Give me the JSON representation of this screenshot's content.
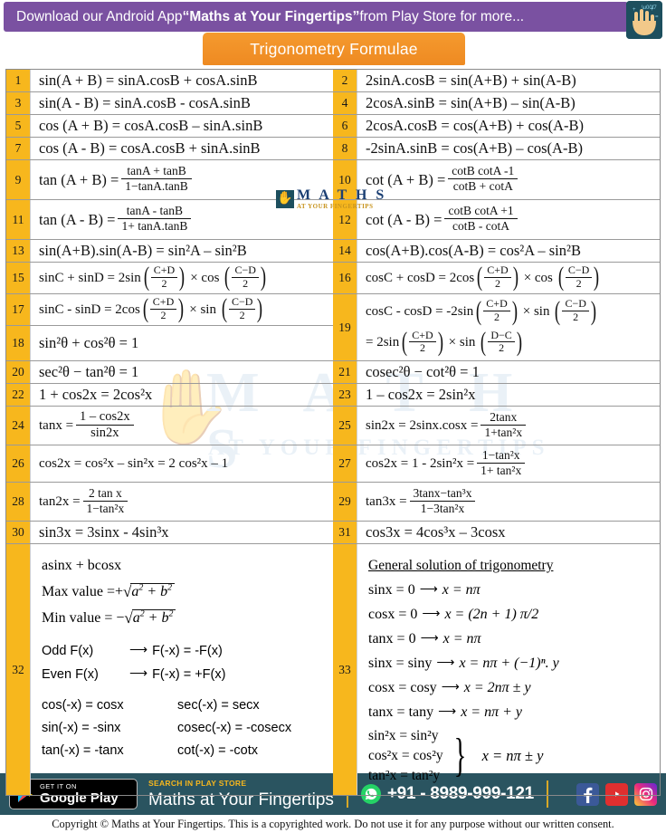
{
  "header": {
    "banner_prefix": "Download our Android App ",
    "banner_app": "“Maths at Your Fingertips”",
    "banner_suffix": " from Play Store for more...",
    "logo_icon": "hand-logo-icon",
    "banner_color": "#7A51A1"
  },
  "title": {
    "text": "Trigonometry Formulae",
    "color": "#EE8A22"
  },
  "watermark": {
    "text": "M A T H S",
    "sub": "AT YOUR FINGERTIPS",
    "mid_text": "M A T H S",
    "mid_sub": "AT YOUR FINGERTIPS"
  },
  "rows": [
    {
      "n": "1",
      "f": "sin(A + B) = sinA.cosB + cosA.sinB"
    },
    {
      "n": "2",
      "f": "2sinA.cosB = sin(A+B) + sin(A-B)"
    },
    {
      "n": "3",
      "f": "sin(A - B) = sinA.cosB - cosA.sinB"
    },
    {
      "n": "4",
      "f": "2cosA.sinB = sin(A+B) – sin(A-B)"
    },
    {
      "n": "5",
      "f": "cos (A + B) = cosA.cosB – sinA.sinB"
    },
    {
      "n": "6",
      "f": "2cosA.cosB = cos(A+B) + cos(A-B)"
    },
    {
      "n": "7",
      "f": "cos (A - B) = cosA.cosB + sinA.sinB"
    },
    {
      "n": "8",
      "f": "-2sinA.sinB = cos(A+B) – cos(A-B)"
    },
    {
      "n": "9",
      "lhs": "tan (A + B) =",
      "num": "tanA + tanB",
      "den": "1−tanA.tanB"
    },
    {
      "n": "10",
      "lhs": "cot (A + B) =",
      "num": "cotB cotA -1",
      "den": "cotB + cotA"
    },
    {
      "n": "11",
      "lhs": "tan (A - B) =",
      "num": "tanA  -  tanB",
      "den": "1+ tanA.tanB"
    },
    {
      "n": "12",
      "lhs": "cot (A - B) =",
      "num": "cotB cotA +1",
      "den": "cotB - cotA"
    },
    {
      "n": "13",
      "f": "sin(A+B).sin(A-B) = sin²A – sin²B"
    },
    {
      "n": "14",
      "f": "cos(A+B).cos(A-B) = cos²A – sin²B"
    },
    {
      "n": "15",
      "lhs": "sinC + sinD = 2sin",
      "p1n": "C+D",
      "p1d": "2",
      "mid": "× cos",
      "p2n": "C−D",
      "p2d": "2"
    },
    {
      "n": "16",
      "lhs": "cosC + cosD = 2cos",
      "p1n": "C+D",
      "p1d": "2",
      "mid": "× cos",
      "p2n": "C−D",
      "p2d": "2"
    },
    {
      "n": "17",
      "lhs": "sinC - sinD = 2cos",
      "p1n": "C+D",
      "p1d": "2",
      "mid": "× sin",
      "p2n": "C−D",
      "p2d": "2"
    },
    {
      "n": "18",
      "f": "sin²θ +  cos²θ = 1"
    },
    {
      "n": "19",
      "lhs": "cosC - cosD = -2sin",
      "p1n": "C+D",
      "p1d": "2",
      "mid": "× sin",
      "p2n": "C−D",
      "p2d": "2",
      "lhs2": "= 2sin",
      "q1n": "C+D",
      "q1d": "2",
      "mid2": "× sin",
      "q2n": "D−C",
      "q2d": "2"
    },
    {
      "n": "20",
      "f": "sec²θ −  tan²θ = 1"
    },
    {
      "n": "21",
      "f": "cosec²θ − cot²θ = 1"
    },
    {
      "n": "22",
      "f": "1 + cos2x = 2cos²x"
    },
    {
      "n": "23",
      "f": "1 – cos2x = 2sin²x"
    },
    {
      "n": "24",
      "lhs": "tanx =",
      "num": "1 – cos2x",
      "den": "sin2x"
    },
    {
      "n": "25",
      "lhs": "sin2x = 2sinx.cosx =",
      "num": "2tanx",
      "den": "1+tan²x"
    },
    {
      "n": "26",
      "f": "cos2x = cos²x – sin²x = 2 cos²x – 1"
    },
    {
      "n": "27",
      "lhs": "cos2x = 1 - 2sin²x =",
      "num": "1−tan²x",
      "den": "1+ tan²x"
    },
    {
      "n": "28",
      "lhs": "tan2x =",
      "num": "2 tan x",
      "den": "1−tan²x"
    },
    {
      "n": "29",
      "lhs": "tan3x =",
      "num": "3tanx−tan³x",
      "den": "1−3tan²x"
    },
    {
      "n": "30",
      "f": "sin3x = 3sinx - 4sin³x"
    },
    {
      "n": "31",
      "f": "cos3x = 4cos³x – 3cosx"
    }
  ],
  "row32": {
    "n": "32",
    "line1": "asinx + bcosx",
    "max_label": "Max value =+",
    "max_val": "a² + b²",
    "min_label": "Min value = −",
    "min_val": "a² + b²",
    "odd": "Odd F(x)",
    "odd_res": "F(-x) = -F(x)",
    "even": "Even F(x)",
    "even_res": "F(-x) = +F(x)",
    "identities": [
      {
        "left": "cos(-x) = cosx",
        "right": "sec(-x) = secx"
      },
      {
        "left": "sin(-x) = -sinx",
        "right": "cosec(-x) = -cosecx"
      },
      {
        "left": "tan(-x) = -tanx",
        "right": "cot(-x) = -cotx"
      }
    ]
  },
  "row33": {
    "n": "33",
    "heading": "General solution of trigonometry",
    "lines": [
      {
        "lhs": "sinx = 0",
        "rhs": "x = nπ"
      },
      {
        "lhs": "cosx = 0",
        "rhs": "x = (2n + 1) π/2"
      },
      {
        "lhs": "tanx = 0",
        "rhs": "x = nπ"
      },
      {
        "lhs": "sinx = siny",
        "rhs": "x = nπ + (−1)ⁿ. y"
      },
      {
        "lhs": "cosx = cosy",
        "rhs": "x = 2nπ ± y"
      },
      {
        "lhs": "tanx = tany",
        "rhs": "x = nπ + y"
      }
    ],
    "brace_lines": [
      "sin²x = sin²y",
      "cos²x = cos²y",
      "tan²x = tan²y"
    ],
    "brace_result": "x = nπ ± y"
  },
  "footer": {
    "google_play_small": "GET IT ON",
    "google_play_big": "Google Play",
    "search_small": "SEARCH IN PLAY STORE",
    "search_big": "Maths at Your Fingertips",
    "whatsapp_number": "+91 - 8989-999-121",
    "social": [
      "facebook-icon",
      "youtube-icon",
      "instagram-icon"
    ],
    "copyright": "Copyright © Maths at Your Fingertips. This is a copyrighted work. Do not use it for any purpose without our written consent."
  }
}
